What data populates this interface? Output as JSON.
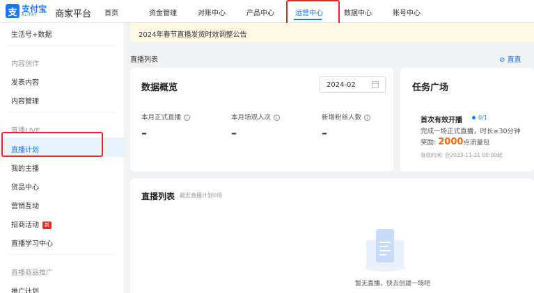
{
  "logo": {
    "mark": "支",
    "name": "支付宝",
    "sub": "ALIPAY"
  },
  "platform": "商家平台",
  "nav": [
    "首页",
    "资金管理",
    "对账中心",
    "产品中心",
    "运营中心",
    "数据中心",
    "账号中心"
  ],
  "sidebar": {
    "top_item": "生活号+数据",
    "group1": "内容创作",
    "group1_items": [
      "发表内容",
      "内容管理"
    ],
    "group2": "直播LIVE",
    "group2_items": [
      "直播计划",
      "我的主播",
      "货品中心",
      "营销互动",
      "招商活动",
      "直播学习中心"
    ],
    "new_badge": "新",
    "group3": "直播商品推广",
    "group3_items": [
      "推广计划"
    ]
  },
  "notice": "2024年春节直播发货时效调整公告",
  "section_title": "直播列表",
  "top_right_link": "直直",
  "overview": {
    "title": "数据概览",
    "date": "2024-02",
    "stats": [
      {
        "label": "本月正式直播",
        "value": "–"
      },
      {
        "label": "本月场观人次",
        "value": "–"
      },
      {
        "label": "新增粉丝人数",
        "value": "–"
      }
    ]
  },
  "tasks": {
    "title": "任务广场",
    "name": "首次有效开播",
    "progress": "0/1",
    "desc": "完成一场正式直播，时长≥30分钟",
    "reward_prefix": "奖励:",
    "reward_num": "2000",
    "reward_suffix": "点流量包",
    "valid": "有效时间: 自2023-11-21 00:00起"
  },
  "live_list": {
    "title": "直播列表",
    "subtitle": "最近直播计划0场",
    "empty": "暂无直播，快去创建一场吧"
  },
  "colors": {
    "accent": "#1677ff",
    "highlight": "#e0282f",
    "reward": "#ff6a00"
  }
}
